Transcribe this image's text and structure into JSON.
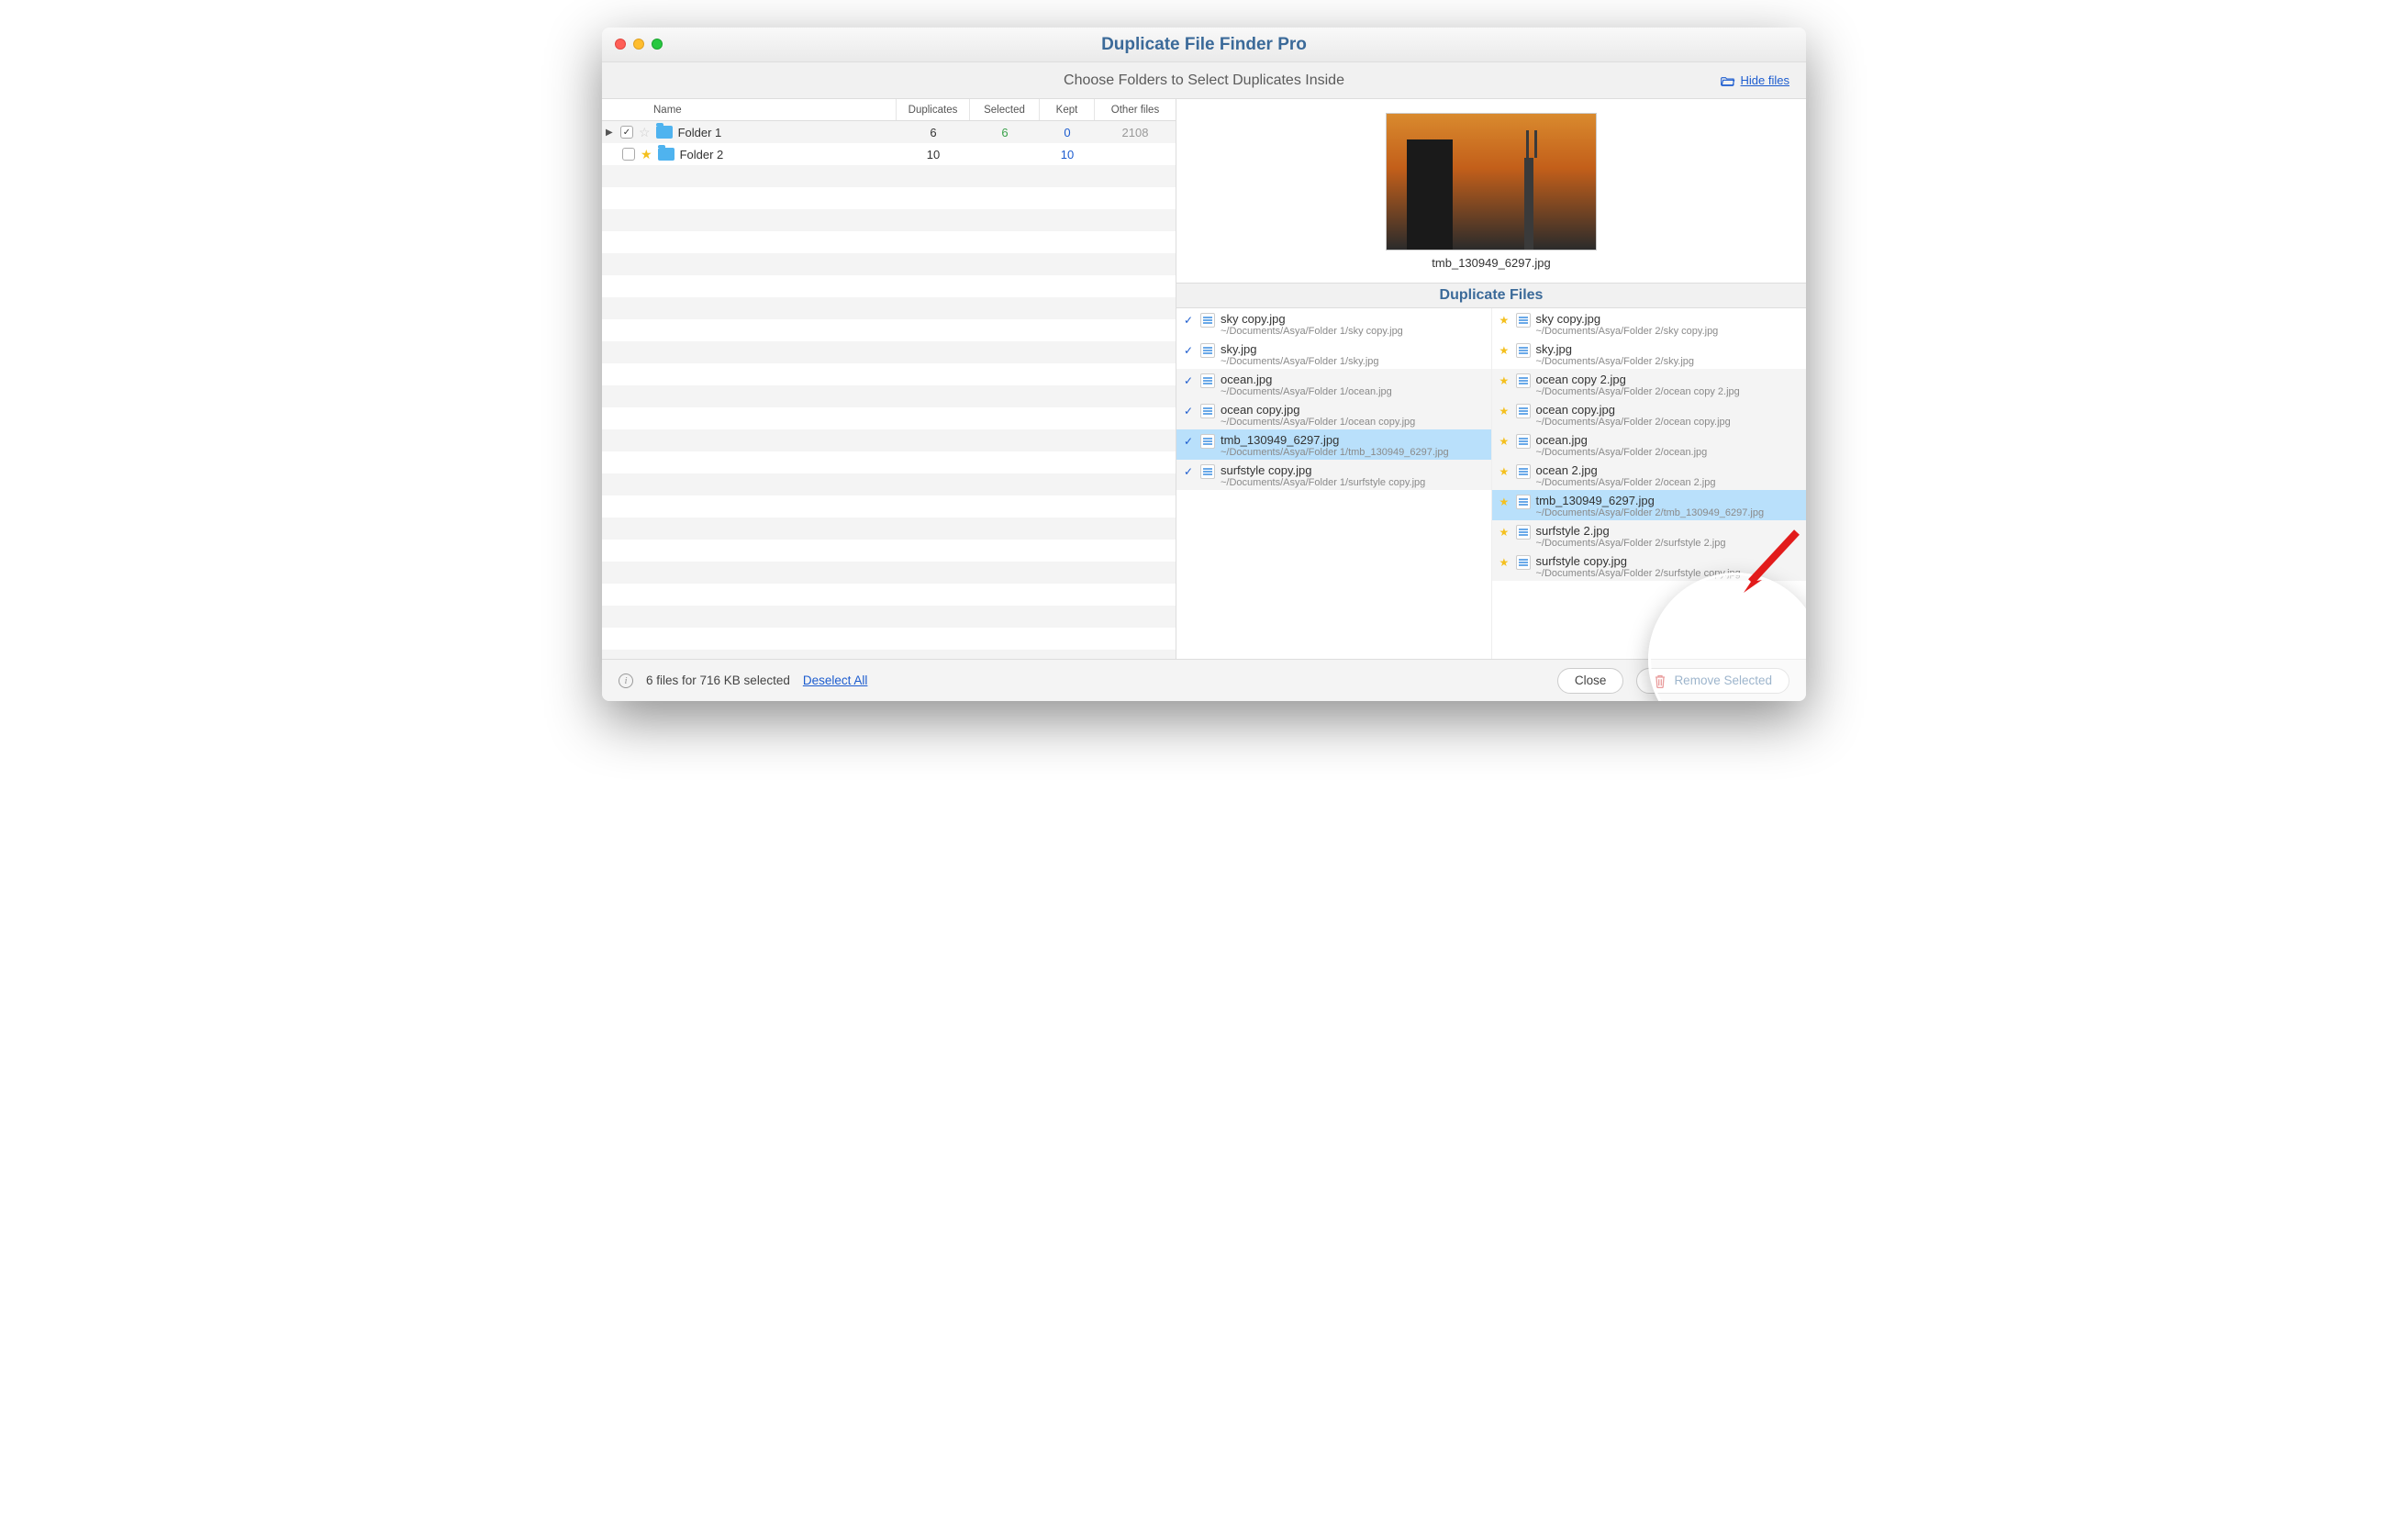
{
  "window": {
    "title": "Duplicate File Finder Pro"
  },
  "subheader": {
    "subtitle": "Choose Folders to Select Duplicates Inside",
    "hide_files": "Hide files"
  },
  "columns": {
    "name": "Name",
    "duplicates": "Duplicates",
    "selected": "Selected",
    "kept": "Kept",
    "other": "Other files"
  },
  "folders": [
    {
      "name": "Folder 1",
      "expanded": true,
      "checked": true,
      "starred": false,
      "duplicates": "6",
      "selected": "6",
      "kept": "0",
      "other": "2108"
    },
    {
      "name": "Folder 2",
      "expanded": false,
      "checked": false,
      "starred": true,
      "duplicates": "10",
      "selected": "",
      "kept": "10",
      "other": ""
    }
  ],
  "preview": {
    "name": "tmb_130949_6297.jpg"
  },
  "duplicates_header": "Duplicate Files",
  "dup_left": [
    {
      "shade": false,
      "selected": false,
      "items": [
        {
          "name": "sky copy.jpg",
          "path": "~/Documents/Asya/Folder 1/sky copy.jpg"
        },
        {
          "name": "sky.jpg",
          "path": "~/Documents/Asya/Folder 1/sky.jpg"
        }
      ]
    },
    {
      "shade": true,
      "selected": false,
      "items": [
        {
          "name": "ocean.jpg",
          "path": "~/Documents/Asya/Folder 1/ocean.jpg"
        },
        {
          "name": "ocean copy.jpg",
          "path": "~/Documents/Asya/Folder 1/ocean copy.jpg"
        }
      ]
    },
    {
      "shade": false,
      "selected": true,
      "items": [
        {
          "name": "tmb_130949_6297.jpg",
          "path": "~/Documents/Asya/Folder 1/tmb_130949_6297.jpg"
        }
      ]
    },
    {
      "shade": true,
      "selected": false,
      "items": [
        {
          "name": "surfstyle copy.jpg",
          "path": "~/Documents/Asya/Folder 1/surfstyle copy.jpg"
        }
      ]
    }
  ],
  "dup_right": [
    {
      "shade": false,
      "selected": false,
      "items": [
        {
          "name": "sky copy.jpg",
          "path": "~/Documents/Asya/Folder 2/sky copy.jpg"
        },
        {
          "name": "sky.jpg",
          "path": "~/Documents/Asya/Folder 2/sky.jpg"
        }
      ]
    },
    {
      "shade": true,
      "selected": false,
      "items": [
        {
          "name": "ocean copy 2.jpg",
          "path": "~/Documents/Asya/Folder 2/ocean copy 2.jpg"
        },
        {
          "name": "ocean copy.jpg",
          "path": "~/Documents/Asya/Folder 2/ocean copy.jpg"
        },
        {
          "name": "ocean.jpg",
          "path": "~/Documents/Asya/Folder 2/ocean.jpg"
        },
        {
          "name": "ocean 2.jpg",
          "path": "~/Documents/Asya/Folder 2/ocean 2.jpg"
        }
      ]
    },
    {
      "shade": false,
      "selected": true,
      "items": [
        {
          "name": "tmb_130949_6297.jpg",
          "path": "~/Documents/Asya/Folder 2/tmb_130949_6297.jpg"
        }
      ]
    },
    {
      "shade": true,
      "selected": false,
      "items": [
        {
          "name": "surfstyle 2.jpg",
          "path": "~/Documents/Asya/Folder 2/surfstyle 2.jpg"
        },
        {
          "name": "surfstyle copy.jpg",
          "path": "~/Documents/Asya/Folder 2/surfstyle copy.jpg"
        }
      ]
    }
  ],
  "footer": {
    "status": "6 files for 716 KB selected",
    "deselect": "Deselect All",
    "close": "Close",
    "remove": "Remove Selected"
  }
}
